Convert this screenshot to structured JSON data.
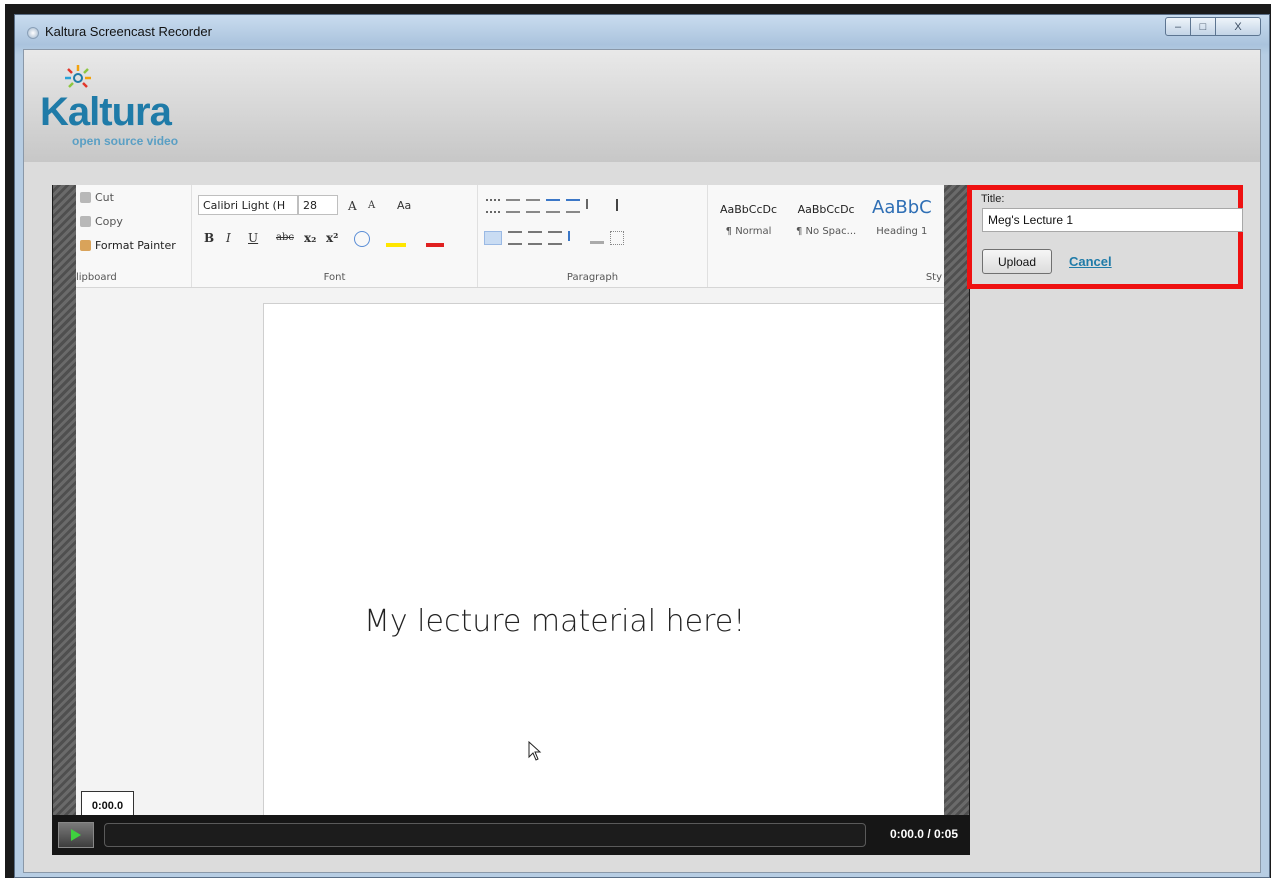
{
  "window": {
    "title": "Kaltura Screencast Recorder",
    "min_glyph": "–",
    "max_glyph": "□",
    "close_glyph": "X"
  },
  "logo": {
    "name": "Kaltura",
    "tagline": "open source video"
  },
  "ribbon": {
    "clipboard": {
      "cut": "Cut",
      "copy": "Copy",
      "format_painter": "Format Painter",
      "label": "lipboard"
    },
    "font": {
      "family": "Calibri Light (H",
      "size": "28",
      "grow": "A",
      "shrink": "A",
      "case": "Aa",
      "bold": "B",
      "italic": "I",
      "underline": "U",
      "strike": "abc",
      "subscript": "x₂",
      "superscript": "x²",
      "label": "Font"
    },
    "paragraph": {
      "label": "Paragraph"
    },
    "styles": {
      "items": [
        {
          "preview": "AaBbCcDc",
          "name": "¶ Normal"
        },
        {
          "preview": "AaBbCcDc",
          "name": "¶ No Spac..."
        },
        {
          "preview": "AaBbC",
          "name": "Heading 1"
        }
      ],
      "label": "Sty"
    }
  },
  "document": {
    "body_text": "My lecture material here!"
  },
  "player": {
    "tooltip_time": "0:00.0",
    "time_display": "0:00.0 / 0:05",
    "progress": 0
  },
  "upload_form": {
    "title_label": "Title:",
    "title_value": "Meg's Lecture 1",
    "upload_label": "Upload",
    "cancel_label": "Cancel"
  },
  "colors": {
    "highlight": "#ee1111",
    "brand": "#1f7ba8"
  }
}
